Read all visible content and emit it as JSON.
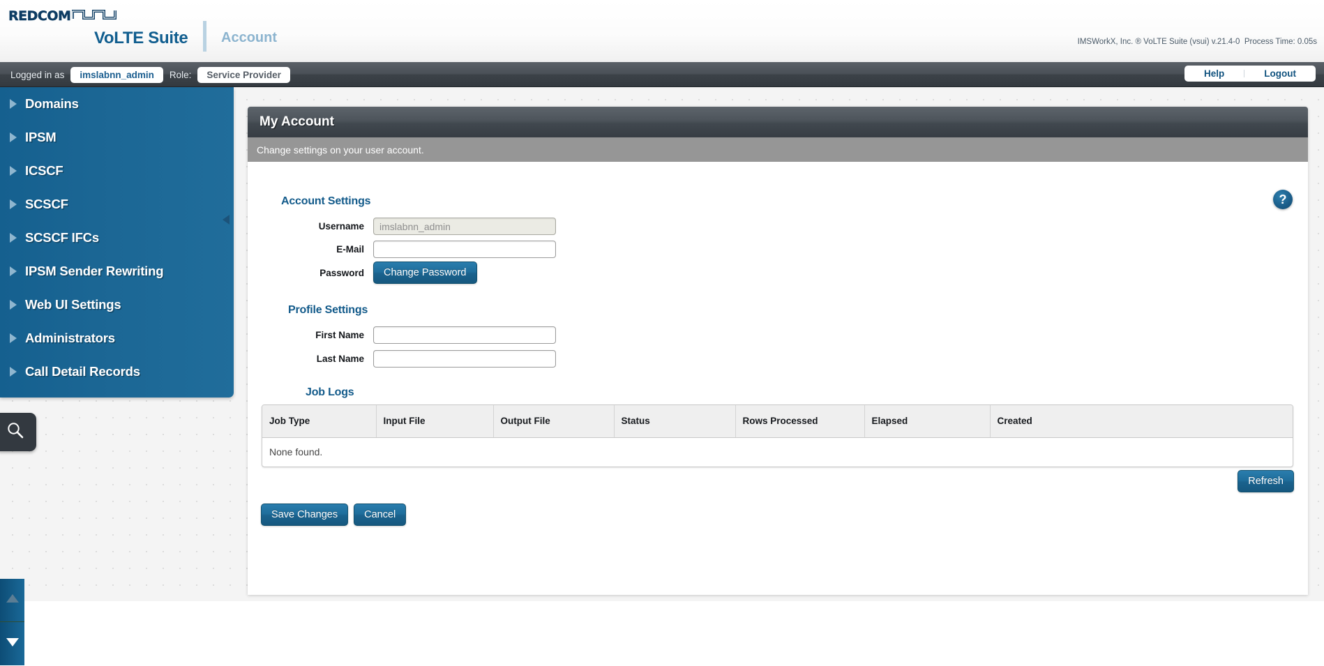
{
  "header": {
    "logo_text": "REDCOM",
    "logo_icon": "waveform-logo-icon",
    "brand_title": "VoLTE Suite",
    "page_title": "Account",
    "version_info": "IMSWorkX, Inc. ® VoLTE Suite (vsui) v.21.4-0  Process Time: 0.05s"
  },
  "loginbar": {
    "logged_in_label": "Logged in as",
    "username": "imslabnn_admin",
    "role_label": "Role:",
    "role": "Service Provider",
    "help": "Help",
    "logout": "Logout"
  },
  "sidebar": {
    "items": [
      {
        "label": "Domains"
      },
      {
        "label": "IPSM"
      },
      {
        "label": "ICSCF"
      },
      {
        "label": "SCSCF"
      },
      {
        "label": "SCSCF IFCs"
      },
      {
        "label": "IPSM Sender Rewriting"
      },
      {
        "label": "Web UI Settings"
      },
      {
        "label": "Administrators"
      },
      {
        "label": "Call Detail Records"
      }
    ]
  },
  "leftwidgets": {
    "search_icon": "magnifier-icon",
    "scroll_up_icon": "triangle-up-icon",
    "scroll_down_icon": "triangle-down-icon"
  },
  "panel": {
    "title": "My Account",
    "subtitle": "Change settings on your user account.",
    "help_icon_label": "?"
  },
  "account_settings": {
    "section_title": "Account Settings",
    "username_label": "Username",
    "username_value": "imslabnn_admin",
    "email_label": "E-Mail",
    "email_value": "",
    "email_placeholder": "",
    "password_label": "Password",
    "change_password_button": "Change Password"
  },
  "profile_settings": {
    "section_title": "Profile Settings",
    "first_name_label": "First Name",
    "first_name_value": "",
    "last_name_label": "Last Name",
    "last_name_value": ""
  },
  "job_logs": {
    "section_title": "Job Logs",
    "columns": [
      "Job Type",
      "Input File",
      "Output File",
      "Status",
      "Rows Processed",
      "Elapsed",
      "Created"
    ],
    "rows": [],
    "empty_text": "None found.",
    "refresh_button": "Refresh"
  },
  "actions": {
    "save_button": "Save Changes",
    "cancel_button": "Cancel"
  },
  "colors": {
    "brand_blue": "#115e8f",
    "sidebar_blue": "#1b6694",
    "button_blue": "#1f6e9c",
    "header_gray": "#41484f",
    "subheader_gray": "#969696"
  }
}
